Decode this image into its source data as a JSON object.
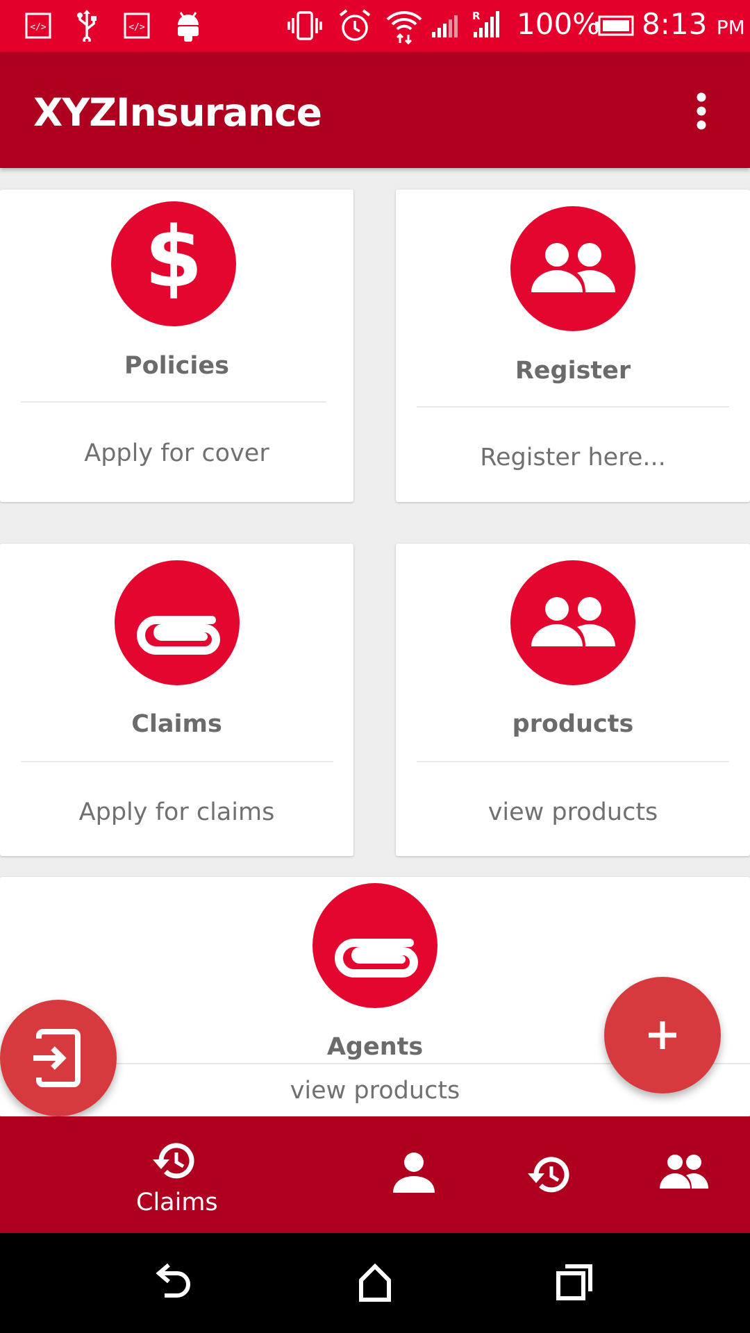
{
  "status_bar": {
    "battery": "100%",
    "time": "8:13",
    "ampm": "PM",
    "icons": [
      "developer-mode-icon",
      "usb-icon",
      "developer-mode-icon",
      "android-icon",
      "vibrate-icon",
      "alarm-icon",
      "wifi-icon",
      "signal-icon",
      "signal-roaming-icon",
      "battery-icon"
    ]
  },
  "app_bar": {
    "title": "XYZInsurance",
    "menu_icon": "more-vert-icon"
  },
  "cards": [
    {
      "title": "Policies",
      "subtitle": "Apply for cover",
      "icon": "dollar-icon"
    },
    {
      "title": "Register",
      "subtitle": "Register here...",
      "icon": "people-icon"
    },
    {
      "title": "Claims",
      "subtitle": "Apply for claims",
      "icon": "paperclip-icon"
    },
    {
      "title": "products",
      "subtitle": "view products",
      "icon": "people-icon"
    },
    {
      "title": "Agents",
      "subtitle": "view products",
      "icon": "paperclip-icon"
    }
  ],
  "fabs": {
    "left_icon": "exit-to-app-icon",
    "right_icon": "add-icon"
  },
  "bottom_nav": {
    "items": [
      {
        "label": "Claims",
        "icon": "history-icon",
        "active": true
      },
      {
        "label": "",
        "icon": "person-icon",
        "active": false
      },
      {
        "label": "",
        "icon": "history-icon",
        "active": false
      },
      {
        "label": "",
        "icon": "people-icon",
        "active": false
      }
    ]
  },
  "system_nav": {
    "icons": [
      "back-icon",
      "home-icon",
      "recents-icon"
    ]
  },
  "colors": {
    "status_bar": "#e3002a",
    "app_bar": "#b00020",
    "icon_circle": "#e3062f",
    "fab": "#d63a3f",
    "background": "#eeeeee"
  }
}
